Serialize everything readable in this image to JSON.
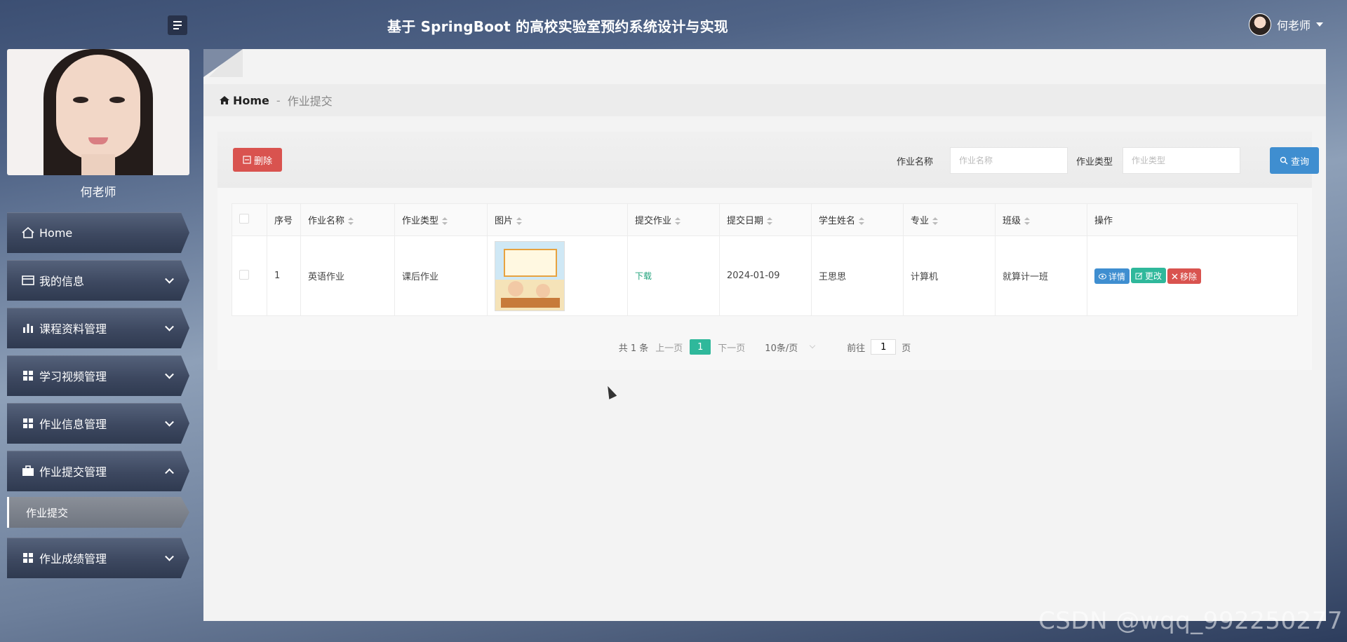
{
  "header": {
    "title": "基于 SpringBoot 的高校实验室预约系统设计与实现",
    "user_name": "何老师"
  },
  "sidebar": {
    "profile_name": "何老师",
    "items": [
      {
        "label": "Home",
        "icon": "home-icon"
      },
      {
        "label": "我的信息",
        "icon": "id-card-icon"
      },
      {
        "label": "课程资料管理",
        "icon": "bar-chart-icon"
      },
      {
        "label": "学习视频管理",
        "icon": "grid-icon"
      },
      {
        "label": "作业信息管理",
        "icon": "grid-icon"
      },
      {
        "label": "作业提交管理",
        "icon": "briefcase-icon",
        "expanded": true
      },
      {
        "label": "作业成绩管理",
        "icon": "grid-icon"
      }
    ],
    "sub_item": "作业提交"
  },
  "breadcrumb": {
    "home": "Home",
    "separator": "-",
    "current": "作业提交"
  },
  "toolbar": {
    "delete_label": "删除",
    "query_label": "查询",
    "search_name_label": "作业名称",
    "search_name_placeholder": "作业名称",
    "search_type_label": "作业类型",
    "search_type_placeholder": "作业类型"
  },
  "table": {
    "columns": [
      "序号",
      "作业名称",
      "作业类型",
      "图片",
      "提交作业",
      "提交日期",
      "学生姓名",
      "专业",
      "班级",
      "操作"
    ],
    "rows": [
      {
        "index": "1",
        "name": "英语作业",
        "type": "课后作业",
        "submit": "下载",
        "date": "2024-01-09",
        "student": "王思思",
        "major": "计算机",
        "class": "就算计一班",
        "actions": [
          "详情",
          "更改",
          "移除"
        ]
      }
    ]
  },
  "pagination": {
    "total": "共 1 条",
    "prev": "上一页",
    "current": "1",
    "next": "下一页",
    "page_size": "10条/页",
    "goto_label": "前往",
    "goto_value": "1",
    "goto_suffix": "页"
  },
  "watermark": "CSDN @wqq_992250277",
  "colors": {
    "delete": "#d9534f",
    "query": "#3f8ed0",
    "edit": "#2fb89b",
    "page_active": "#2fb89b"
  }
}
